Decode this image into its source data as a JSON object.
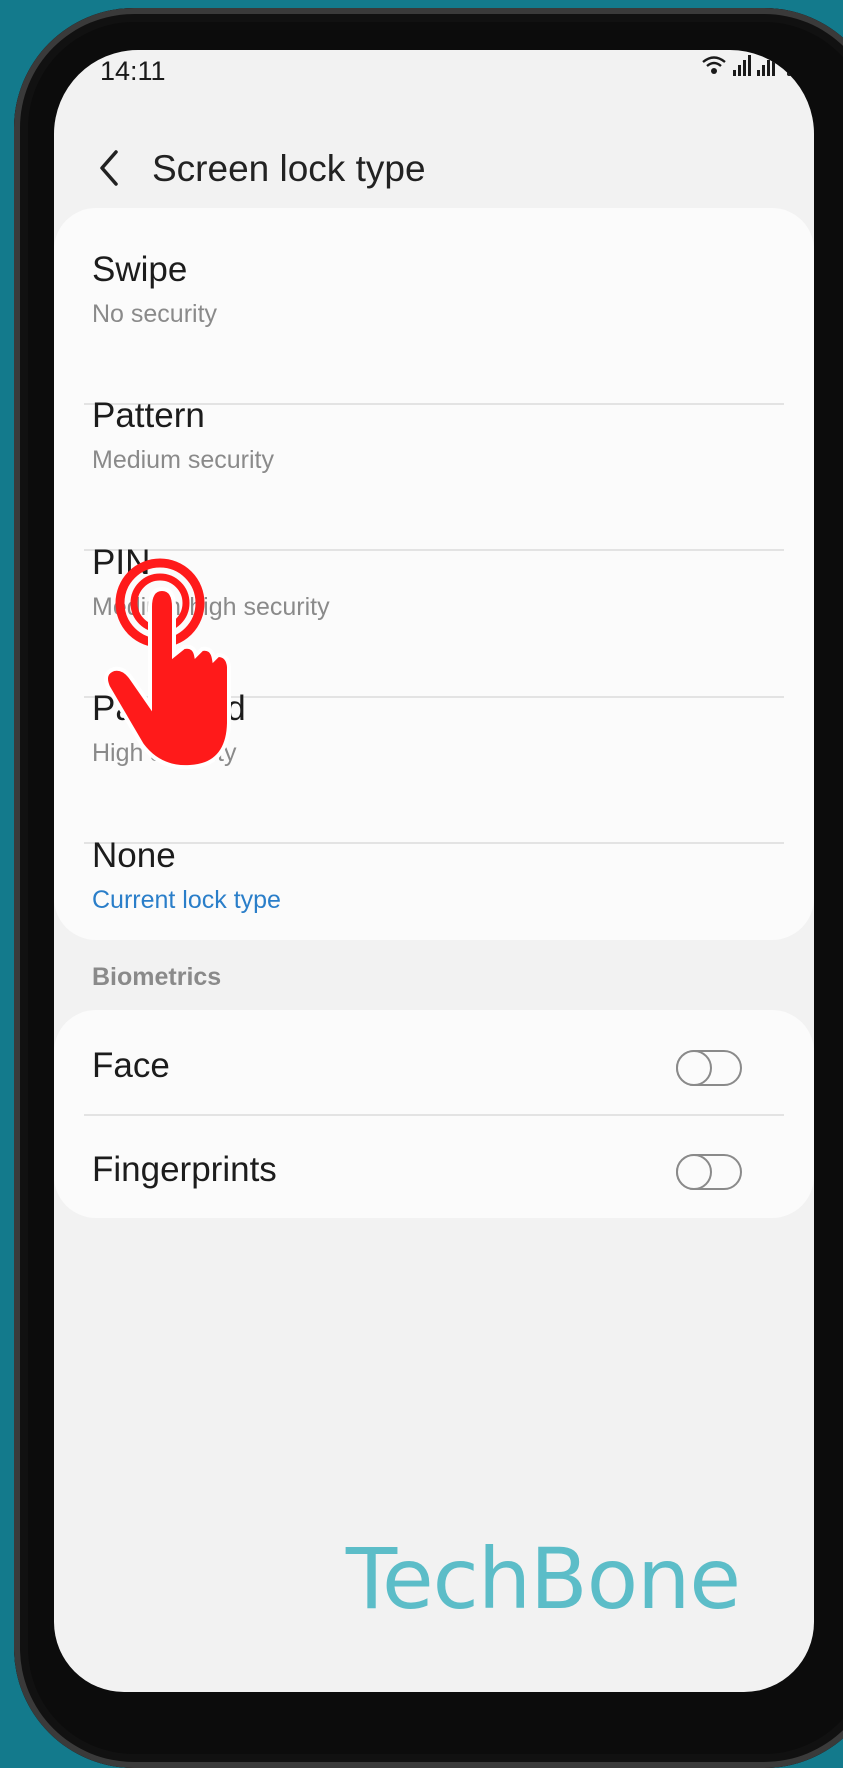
{
  "status": {
    "time": "14:11"
  },
  "header": {
    "title": "Screen lock type"
  },
  "lock_options": [
    {
      "title": "Swipe",
      "subtitle": "No security"
    },
    {
      "title": "Pattern",
      "subtitle": "Medium security"
    },
    {
      "title": "PIN",
      "subtitle": "Medium-high security"
    },
    {
      "title": "Password",
      "subtitle": "High security"
    },
    {
      "title": "None",
      "subtitle": "Current lock type"
    }
  ],
  "biometrics": {
    "section_title": "Biometrics",
    "items": [
      {
        "title": "Face",
        "enabled": false
      },
      {
        "title": "Fingerprints",
        "enabled": false
      }
    ]
  },
  "watermark": "TechBone",
  "colors": {
    "accent": "#2a7ec9",
    "tap_indicator": "#ff1a1a",
    "background": "#137a8c"
  }
}
